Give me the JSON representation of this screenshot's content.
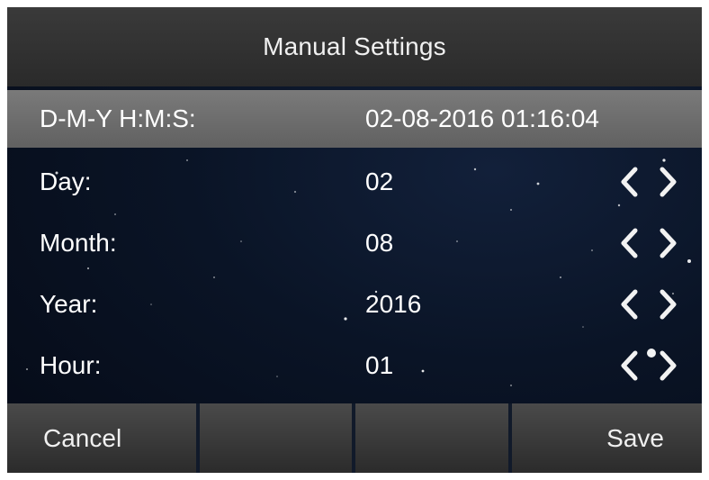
{
  "title": "Manual Settings",
  "rows": [
    {
      "label": "D-M-Y H:M:S:",
      "value": "02-08-2016 01:16:04"
    },
    {
      "label": "Day:",
      "value": "02"
    },
    {
      "label": "Month:",
      "value": "08"
    },
    {
      "label": "Year:",
      "value": "2016"
    },
    {
      "label": "Hour:",
      "value": "01"
    }
  ],
  "softkeys": [
    {
      "label": "Cancel"
    },
    {
      "label": ""
    },
    {
      "label": ""
    },
    {
      "label": "Save"
    }
  ],
  "icons": {
    "decrement": "chevron-left-icon",
    "increment": "chevron-right-icon"
  },
  "colors": {
    "titlebar": "#333333",
    "selected_row": "#6e6e6e",
    "softkey": "#3a3a3a",
    "text": "#ffffff"
  }
}
